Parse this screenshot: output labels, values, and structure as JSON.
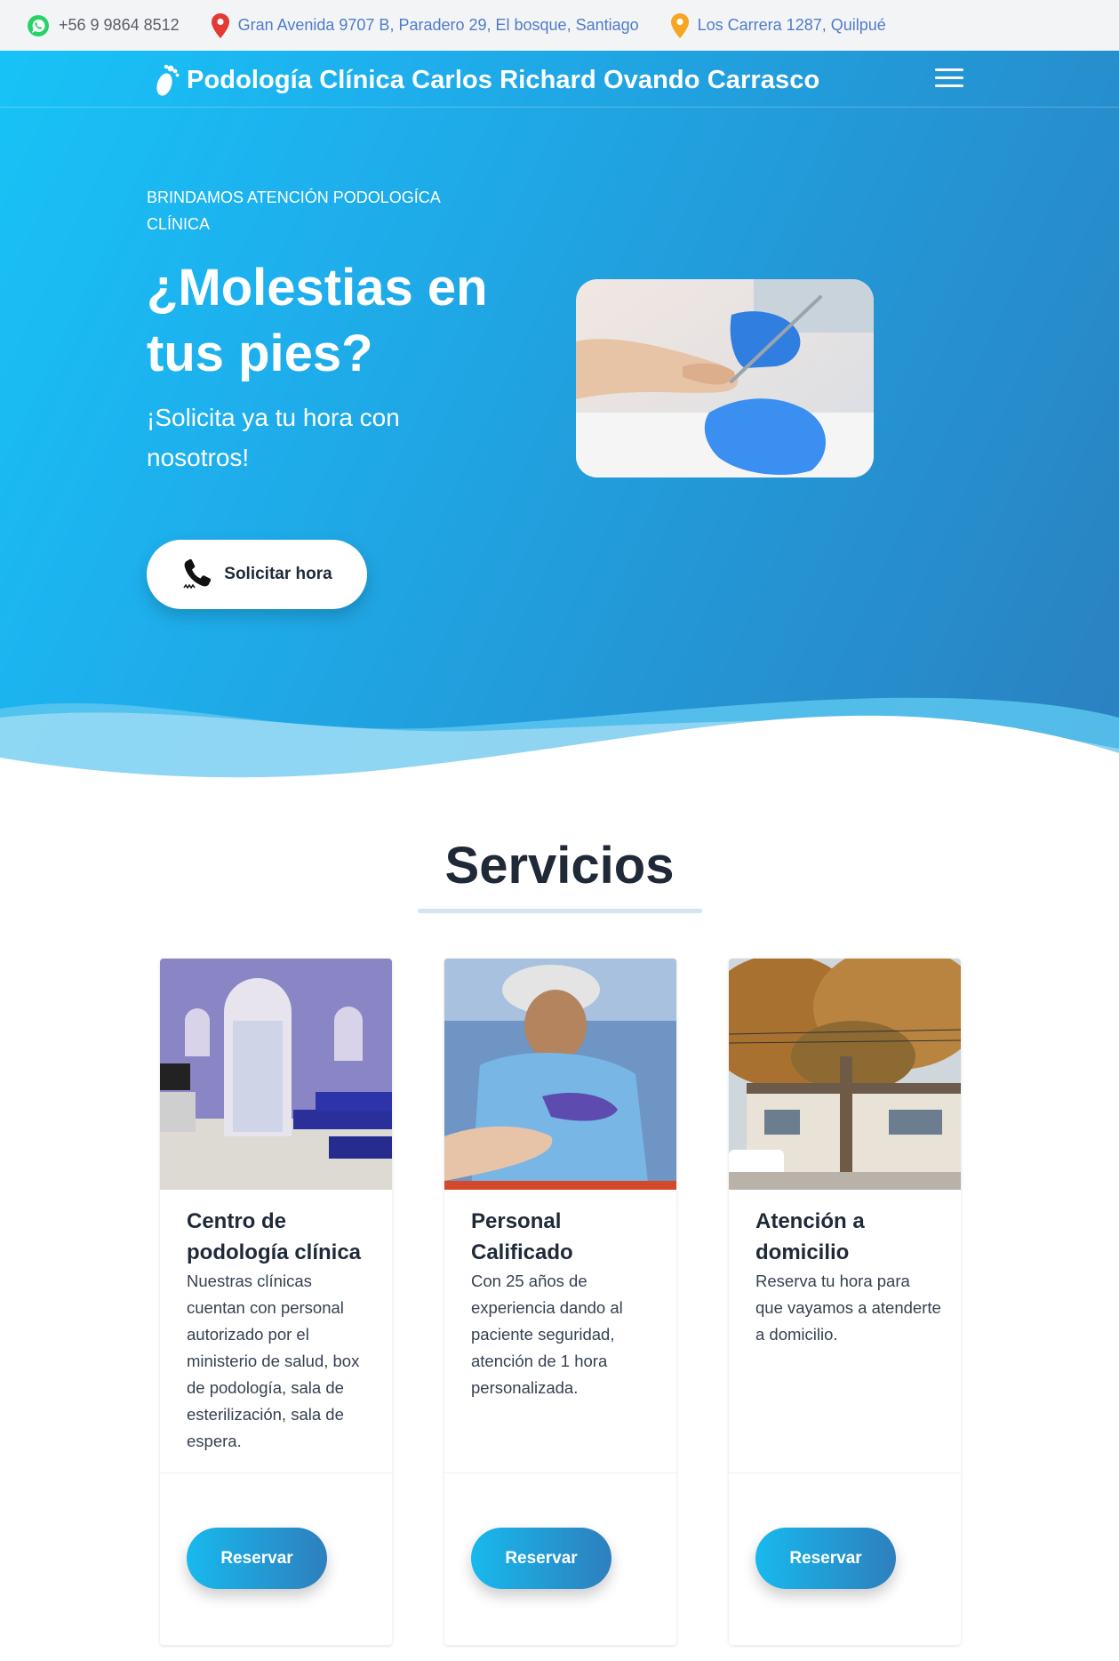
{
  "topbar": {
    "phone": "+56 9 9864 8512",
    "address_1": "Gran Avenida 9707 B, Paradero 29, El bosque, Santiago",
    "address_2": "Los Carrera 1287, Quilpué"
  },
  "nav": {
    "brand": "Podología Clínica Carlos Richard Ovando Carrasco",
    "menu_icon": "hamburger-menu-icon"
  },
  "hero": {
    "eyebrow": "BRINDAMOS ATENCIÓN PODOLOGÍCA CLÍNICA",
    "headline": "¿Molestias en tus pies?",
    "subline": "¡Solicita ya tu hora con nosotros!",
    "cta_label": "Solicitar hora"
  },
  "services": {
    "title": "Servicios",
    "cards": [
      {
        "title": "Centro de podología clínica",
        "text": "Nuestras clínicas cuentan con personal autorizado por el ministerio de salud, box de podología, sala de esterilización, sala de espera.",
        "button": "Reservar"
      },
      {
        "title": "Personal Calificado",
        "text": "Con 25 años de experiencia dando al paciente seguridad, atención de 1 hora personalizada.",
        "button": "Reservar"
      },
      {
        "title": "Atención a domicilio",
        "text": "Reserva tu hora para que vayamos a atenderte a domicilio.",
        "button": "Reservar"
      }
    ]
  },
  "colors": {
    "hero_start": "#17c3f6",
    "hero_end": "#2b80bf",
    "whatsapp": "#25d366",
    "pin_red": "#e53935",
    "pin_orange": "#f5a623",
    "address_link": "#4f7cc9"
  }
}
